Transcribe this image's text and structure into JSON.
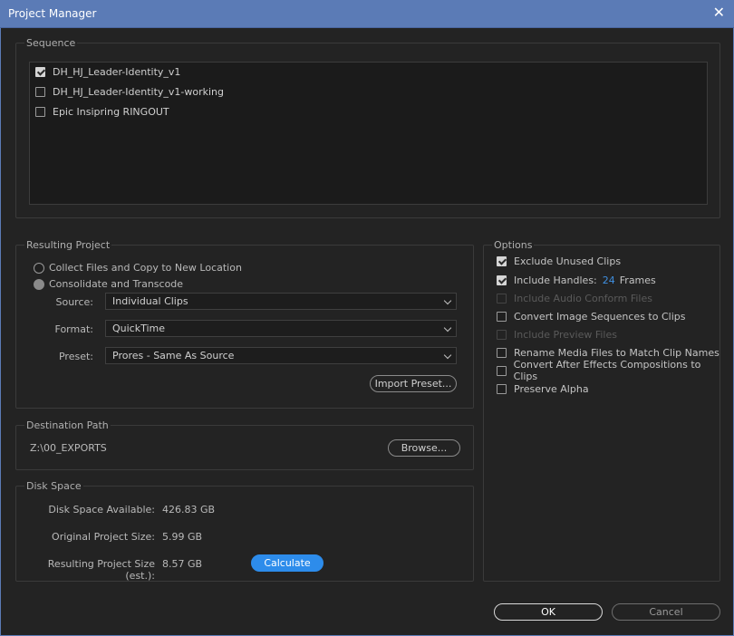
{
  "window": {
    "title": "Project Manager",
    "close_glyph": "✕"
  },
  "sequence": {
    "legend": "Sequence",
    "items": [
      {
        "label": "DH_HJ_Leader-Identity_v1",
        "checked": true
      },
      {
        "label": "DH_HJ_Leader-Identity_v1-working",
        "checked": false
      },
      {
        "label": "Epic Insipring RINGOUT",
        "checked": false
      }
    ]
  },
  "resulting_project": {
    "legend": "Resulting Project",
    "options": [
      {
        "label": "Collect Files and Copy to New Location",
        "selected": false
      },
      {
        "label": "Consolidate and Transcode",
        "selected": true
      }
    ],
    "source": {
      "label": "Source:",
      "value": "Individual Clips"
    },
    "format": {
      "label": "Format:",
      "value": "QuickTime"
    },
    "preset": {
      "label": "Preset:",
      "value": "Prores - Same As Source"
    },
    "import_preset_label": "Import Preset..."
  },
  "options": {
    "legend": "Options",
    "exclude_unused": {
      "label": "Exclude Unused Clips",
      "checked": true
    },
    "include_handles": {
      "label": "Include Handles:",
      "value": "24",
      "unit": "Frames",
      "checked": true
    },
    "include_audio_conform": {
      "label": "Include Audio Conform Files",
      "checked": false,
      "disabled": true
    },
    "convert_image_seq": {
      "label": "Convert Image Sequences to Clips",
      "checked": false
    },
    "include_preview": {
      "label": "Include Preview Files",
      "checked": false,
      "disabled": true
    },
    "rename_media": {
      "label": "Rename Media Files to Match Clip Names",
      "checked": false
    },
    "convert_ae": {
      "label": "Convert After Effects Compositions to Clips",
      "checked": false
    },
    "preserve_alpha": {
      "label": "Preserve Alpha",
      "checked": false
    }
  },
  "destination": {
    "legend": "Destination Path",
    "path": "Z:\\00_EXPORTS",
    "browse_label": "Browse..."
  },
  "disk_space": {
    "legend": "Disk Space",
    "available_label": "Disk Space Available:",
    "available_value": "426.83 GB",
    "original_label": "Original Project Size:",
    "original_value": "5.99 GB",
    "resulting_label": "Resulting Project Size (est.):",
    "resulting_value": "8.57 GB",
    "calculate_label": "Calculate"
  },
  "footer": {
    "ok_label": "OK",
    "cancel_label": "Cancel"
  },
  "colors": {
    "title_bar": "#5b7bb6",
    "accent": "#2d8ceb",
    "background": "#232323"
  }
}
